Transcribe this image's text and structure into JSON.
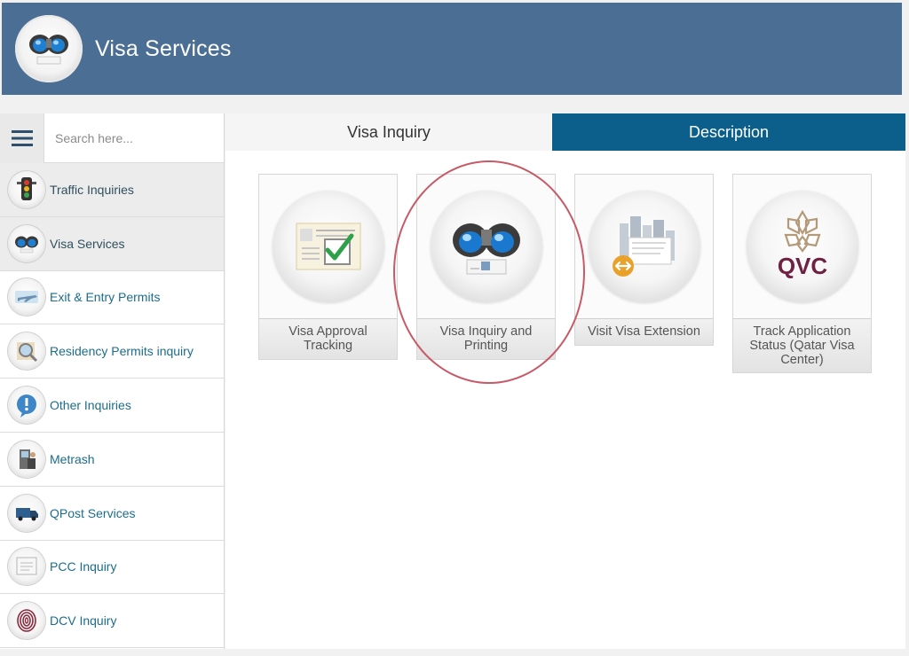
{
  "header": {
    "title": "Visa Services",
    "logo_icon": "binoculars-icon",
    "color": "#4b6f94"
  },
  "sidebar": {
    "search": {
      "placeholder": "Search here...",
      "value": ""
    },
    "menu_icon": "hamburger-icon",
    "items": [
      {
        "label": "Traffic Inquiries",
        "icon": "traffic-light-icon"
      },
      {
        "label": "Visa Services",
        "icon": "binoculars-icon"
      },
      {
        "label": "Exit & Entry Permits",
        "icon": "airplane-icon"
      },
      {
        "label": "Residency Permits inquiry",
        "icon": "magnifier-icon"
      },
      {
        "label": "Other Inquiries",
        "icon": "exclamation-icon"
      },
      {
        "label": "Metrash",
        "icon": "kiosk-icon"
      },
      {
        "label": "QPost Services",
        "icon": "delivery-truck-icon"
      },
      {
        "label": "PCC Inquiry",
        "icon": "certificate-icon"
      },
      {
        "label": "DCV Inquiry",
        "icon": "fingerprint-icon"
      }
    ]
  },
  "main": {
    "tabs": [
      {
        "label": "Visa Inquiry",
        "active": true
      },
      {
        "label": "Description",
        "active": false,
        "color": "#0c5f8a"
      }
    ],
    "cards": [
      {
        "label": "Visa Approval Tracking",
        "icon": "approved-document-icon"
      },
      {
        "label": "Visa Inquiry and Printing",
        "icon": "binoculars-icon",
        "highlighted": true
      },
      {
        "label": "Visit Visa Extension",
        "icon": "city-extension-icon"
      },
      {
        "label": "Track Application Status (Qatar Visa Center)",
        "icon": "qvc-logo-icon",
        "logo_text": "QVC"
      }
    ]
  },
  "colors": {
    "accent": "#0c5f8a",
    "link": "#1c6d8c",
    "highlight": "#c75a67"
  }
}
